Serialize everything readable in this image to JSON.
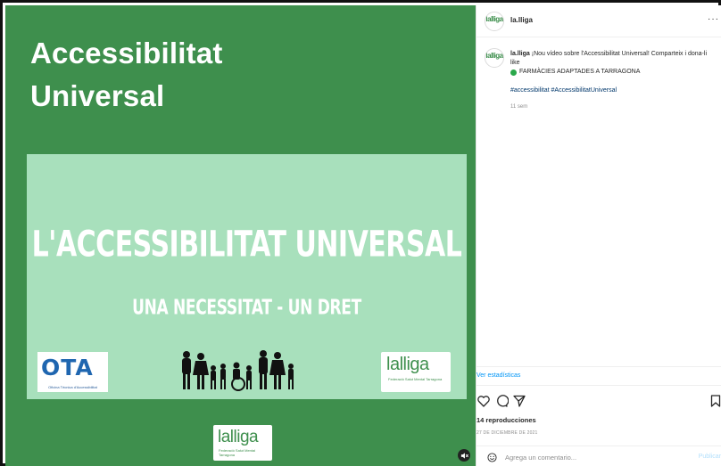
{
  "colors": {
    "brand_green": "#3e8f4d",
    "slide_green": "#a8e0bc",
    "link_blue": "#0095f6",
    "hashtag_blue": "#00376b"
  },
  "media": {
    "title_line1": "Accessibilitat",
    "title_line2": "Universal",
    "slide_heading": "L'ACCESSIBILITAT UNIVERSAL",
    "slide_subheading": "UNA NECESSITAT - UN DRET",
    "logo_left": {
      "main": "OTA",
      "caption": "Oficina Tècnica d'Accessibilitat"
    },
    "logo_lalliga": {
      "text": "lalliga",
      "caption": "Federació Salut Mental Tarragona"
    },
    "icons": {
      "family": "family-silhouette-icon",
      "mute": "speaker-muted-icon"
    }
  },
  "post": {
    "username": "la.lliga",
    "avatar_text": "lalliga",
    "more_label": "···",
    "caption_text": "¡Nou vídeo sobre l'Accessibilitat Universal! Comparteix i dona-li like",
    "store_line": "FARMÀCIES ADAPTADES A TARRAGONA",
    "hashtags": "#accessibilitat #AccessibilitatUniversal",
    "time_ago": "11 sem",
    "stats_link": "Ver estadísticas",
    "views": "14 reproducciones",
    "date": "27 DE DICIEMBRE DE 2021",
    "comment_placeholder": "Agrega un comentario...",
    "publish_label": "Publicar",
    "icons": {
      "like": "heart-icon",
      "comment": "comment-icon",
      "share": "send-icon",
      "save": "bookmark-icon",
      "emoji": "smiley-icon"
    }
  }
}
